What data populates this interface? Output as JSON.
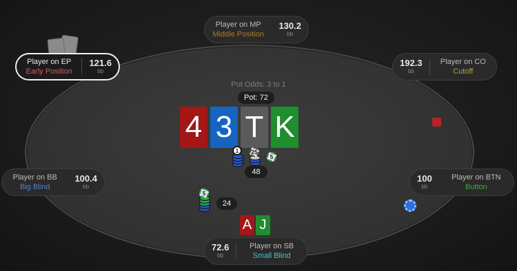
{
  "pot_odds": "Pot Odds: 3 to 1",
  "pot": "Pot: 72",
  "board": [
    {
      "rank": "4",
      "color": "#a31717"
    },
    {
      "rank": "3",
      "color": "#1565c0"
    },
    {
      "rank": "T",
      "color": "#5b5b5b"
    },
    {
      "rank": "K",
      "color": "#1e8e2e"
    }
  ],
  "hole_cards": [
    {
      "rank": "A",
      "color": "#a31717"
    },
    {
      "rank": "J",
      "color": "#1e8e2e"
    }
  ],
  "seats": {
    "mp": {
      "name": "Player on MP",
      "position": "Middle Position",
      "stack": "130.2",
      "unit": "bb",
      "color": "#b07a1e"
    },
    "ep": {
      "name": "Player on EP",
      "position": "Early Position",
      "stack": "121.6",
      "unit": "bb",
      "color": "#e05858"
    },
    "co": {
      "name": "Player on CO",
      "position": "Cutoff",
      "stack": "192.3",
      "unit": "bb",
      "color": "#b8a92a"
    },
    "bb": {
      "name": "Player on BB",
      "position": "Big Blind",
      "stack": "100.4",
      "unit": "bb",
      "color": "#4d84c8"
    },
    "btn": {
      "name": "Player on BTN",
      "position": "Button",
      "stack": "100",
      "unit": "bb",
      "color": "#3fa843"
    },
    "sb": {
      "name": "Player on SB",
      "position": "Small Blind",
      "stack": "72.6",
      "unit": "bb",
      "color": "#3ec9c9"
    }
  },
  "bets": {
    "center": "48",
    "sb": "24"
  },
  "chips": {
    "c1": "1",
    "c25": "25",
    "c5a": "5",
    "c5b": "5"
  }
}
